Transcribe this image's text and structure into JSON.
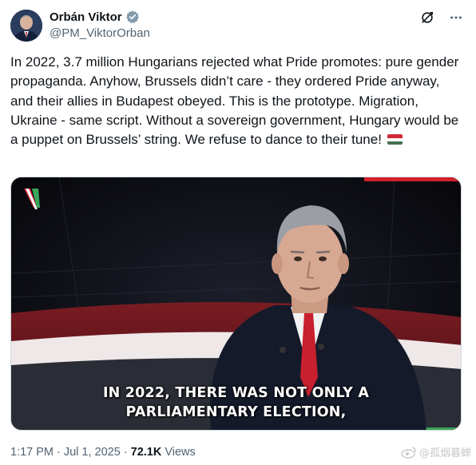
{
  "author": {
    "display_name": "Orbán Viktor",
    "handle": "@PM_ViktorOrban",
    "verified": true,
    "verified_color": "#829aab"
  },
  "tweet": {
    "text": "In 2022, 3.7 million Hungarians rejected what Pride promotes: pure gender propaganda. Anyhow, Brussels didn’t care - they ordered Pride anyway, and their allies in Budapest obeyed. This is the prototype. Migration, Ukraine - same script. Without a sovereign government, Hungary would be a puppet on Brussels’ string. We refuse to dance to their tune!",
    "emoji": "hungarian-flag",
    "flag_colors": [
      "#ce2939",
      "#ffffff",
      "#477050"
    ]
  },
  "media": {
    "caption_line1": "IN 2022, THERE WAS NOT ONLY A",
    "caption_line2": "PARLIAMENTARY ELECTION,"
  },
  "meta": {
    "time": "1:17 PM",
    "separator1": "·",
    "date": "Jul 1, 2025",
    "separator2": "·",
    "views_count": "72.1K",
    "views_label": "Views"
  },
  "watermark": {
    "text": "@孤烟暮蝉",
    "icon": "weibo-icon"
  },
  "icons": {
    "grok": "grok-icon",
    "more": "more-icon"
  }
}
